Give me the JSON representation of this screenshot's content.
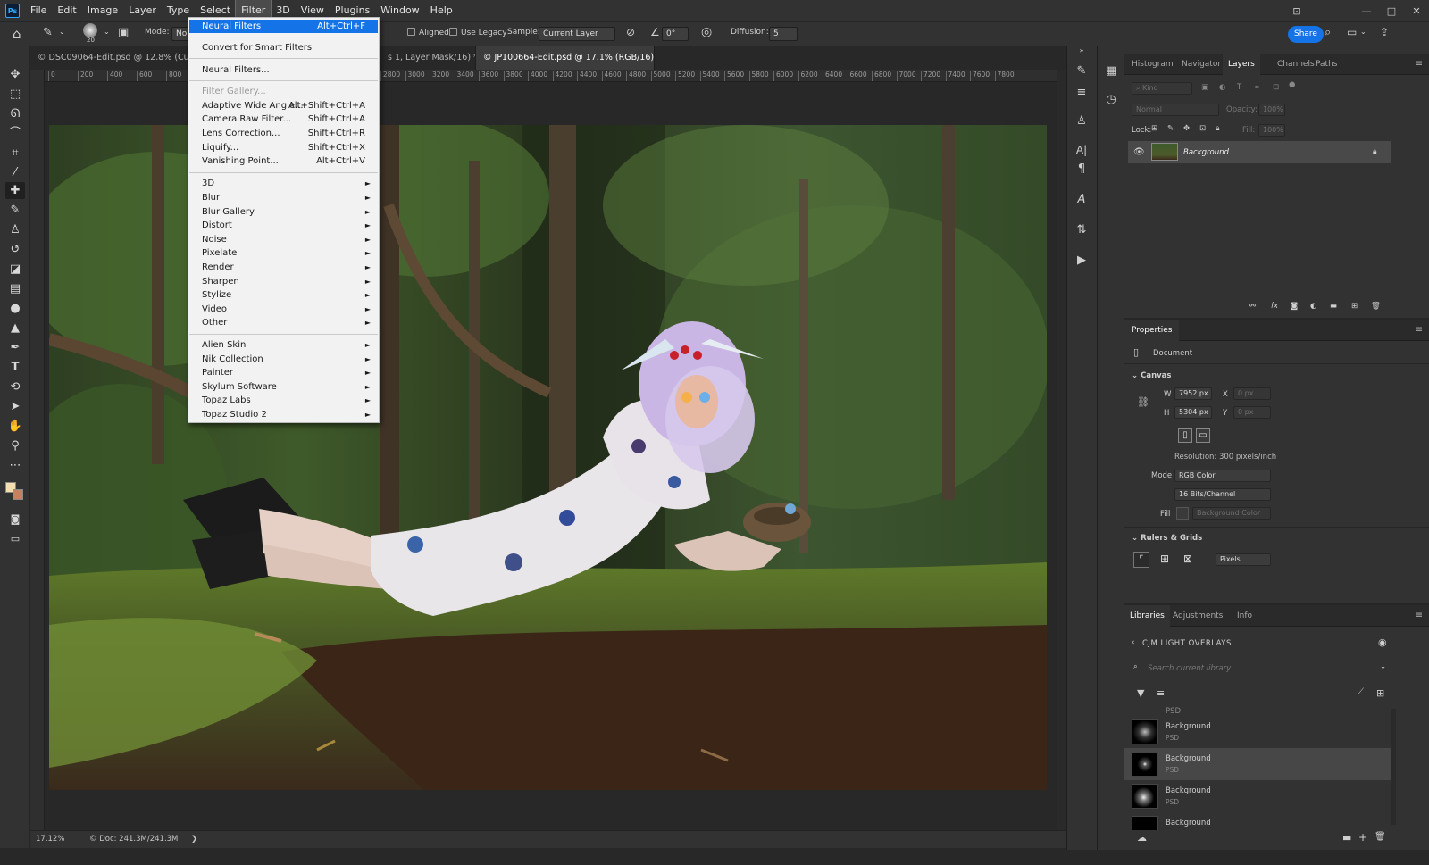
{
  "menubar": {
    "logo": "Ps",
    "items": [
      "File",
      "Edit",
      "Image",
      "Layer",
      "Type",
      "Select",
      "Filter",
      "3D",
      "View",
      "Plugins",
      "Window",
      "Help"
    ],
    "active_item": "Filter"
  },
  "options_bar": {
    "brush_size": "20",
    "mode_label": "Mode:",
    "mode_value": "Nor",
    "aligned_label": "Aligned",
    "use_legacy_label": "Use Legacy",
    "sample_label": "Sample:",
    "sample_value": "Current Layer",
    "angle_value": "0°",
    "diffusion_label": "Diffusion:",
    "diffusion_value": "5",
    "share_label": "Share"
  },
  "doc_tabs": [
    {
      "title": "© DSC09064-Edit.psd @ 12.8% (Curves",
      "active": false
    },
    {
      "title": "s 1, Layer Mask/16) *",
      "close": "×",
      "active": false
    },
    {
      "title": "© JP100664-Edit.psd @ 17.1% (RGB/16)",
      "close": "×",
      "active": true
    }
  ],
  "ruler_ticks": [
    "0",
    "200",
    "400",
    "600",
    "800",
    "2800",
    "3000",
    "3200",
    "3400",
    "3600",
    "3800",
    "4000",
    "4200",
    "4400",
    "4600",
    "4800",
    "5000",
    "5200",
    "5400",
    "5600",
    "5800",
    "6000",
    "6200",
    "6400",
    "6600",
    "6800",
    "7000",
    "7200",
    "7400",
    "7600",
    "7800"
  ],
  "status": {
    "zoom": "17.12%",
    "doc": "© Doc: 241.3M/241.3M",
    "arrow": "❯"
  },
  "filter_menu": {
    "items": [
      {
        "label": "Neural Filters",
        "shortcut": "Alt+Ctrl+F"
      },
      {
        "label": "Convert for Smart Filters"
      },
      {
        "label": "Neural Filters..."
      },
      {
        "label": "Filter Gallery..."
      },
      {
        "label": "Adaptive Wide Angle...",
        "shortcut": "Alt+Shift+Ctrl+A"
      },
      {
        "label": "Camera Raw Filter...",
        "shortcut": "Shift+Ctrl+A"
      },
      {
        "label": "Lens Correction...",
        "shortcut": "Shift+Ctrl+R"
      },
      {
        "label": "Liquify...",
        "shortcut": "Shift+Ctrl+X"
      },
      {
        "label": "Vanishing Point...",
        "shortcut": "Alt+Ctrl+V"
      },
      {
        "label": "3D"
      },
      {
        "label": "Blur"
      },
      {
        "label": "Blur Gallery"
      },
      {
        "label": "Distort"
      },
      {
        "label": "Noise"
      },
      {
        "label": "Pixelate"
      },
      {
        "label": "Render"
      },
      {
        "label": "Sharpen"
      },
      {
        "label": "Stylize"
      },
      {
        "label": "Video"
      },
      {
        "label": "Other"
      },
      {
        "label": "Alien Skin"
      },
      {
        "label": "Nik Collection"
      },
      {
        "label": "Painter"
      },
      {
        "label": "Skylum Software"
      },
      {
        "label": "Topaz Labs"
      },
      {
        "label": "Topaz Studio 2"
      }
    ],
    "highlighted": "Neural Filters",
    "disabled": [
      "Filter Gallery..."
    ],
    "submenu_arrow": "►"
  },
  "layers_panel": {
    "tabs": [
      "Histogram",
      "Navigator",
      "Layers",
      "Channels",
      "Paths"
    ],
    "active_tab": "Layers",
    "kind_placeholder": "Kind",
    "blend_mode": "Normal",
    "opacity_label": "Opacity:",
    "opacity_value": "100%",
    "lock_label": "Lock:",
    "fill_label": "Fill:",
    "fill_value": "100%",
    "layers": [
      {
        "name": "Background",
        "visible": true,
        "locked": true
      }
    ]
  },
  "properties_panel": {
    "title": "Properties",
    "type": "Document",
    "canvas_heading": "Canvas",
    "w_label": "W",
    "w_value": "7952 px",
    "h_label": "H",
    "h_value": "5304 px",
    "x_label": "X",
    "x_value": "0 px",
    "y_label": "Y",
    "y_value": "0 px",
    "resolution": "Resolution: 300 pixels/inch",
    "mode_label": "Mode",
    "mode_value": "RGB Color",
    "depth_value": "16 Bits/Channel",
    "fill_label": "Fill",
    "fill_value": "Background Color",
    "rulers_heading": "Rulers & Grids",
    "units_value": "Pixels"
  },
  "libraries_panel": {
    "tabs": [
      "Libraries",
      "Adjustments",
      "Info"
    ],
    "active_tab": "Libraries",
    "library_name": "CJM LIGHT OVERLAYS",
    "search_placeholder": "Search current library",
    "top_partial": "PSD",
    "items": [
      {
        "name": "Background",
        "type": "PSD"
      },
      {
        "name": "Background",
        "type": "PSD"
      },
      {
        "name": "Background",
        "type": "PSD"
      },
      {
        "name": "Background",
        "type": ""
      }
    ],
    "selected_index": 1
  },
  "colors": {
    "accent": "#1473e6",
    "ui_bg": "#323232",
    "canvas_bg": "#282828",
    "menu_bg": "#f2f2f2"
  }
}
